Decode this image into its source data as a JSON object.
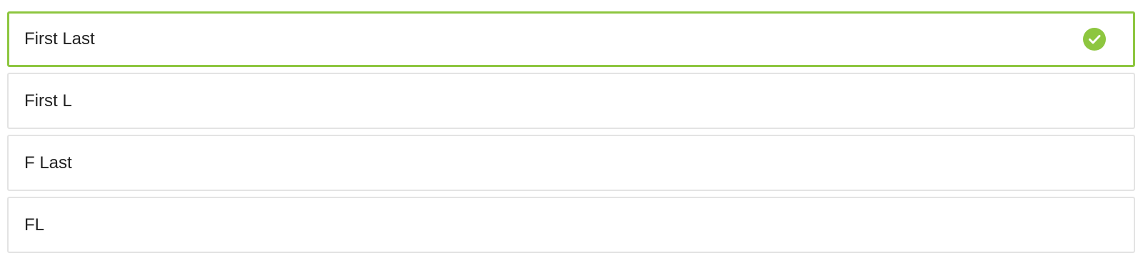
{
  "name_format_options": {
    "items": [
      {
        "label": "First Last",
        "selected": true
      },
      {
        "label": "First L",
        "selected": false
      },
      {
        "label": "F Last",
        "selected": false
      },
      {
        "label": "FL",
        "selected": false
      }
    ],
    "selected_icon": "check-circle-icon"
  },
  "colors": {
    "selected_border": "#8dc63f",
    "default_border": "#e3e3e3",
    "check_fill": "#8dc63f",
    "text": "#222222"
  }
}
